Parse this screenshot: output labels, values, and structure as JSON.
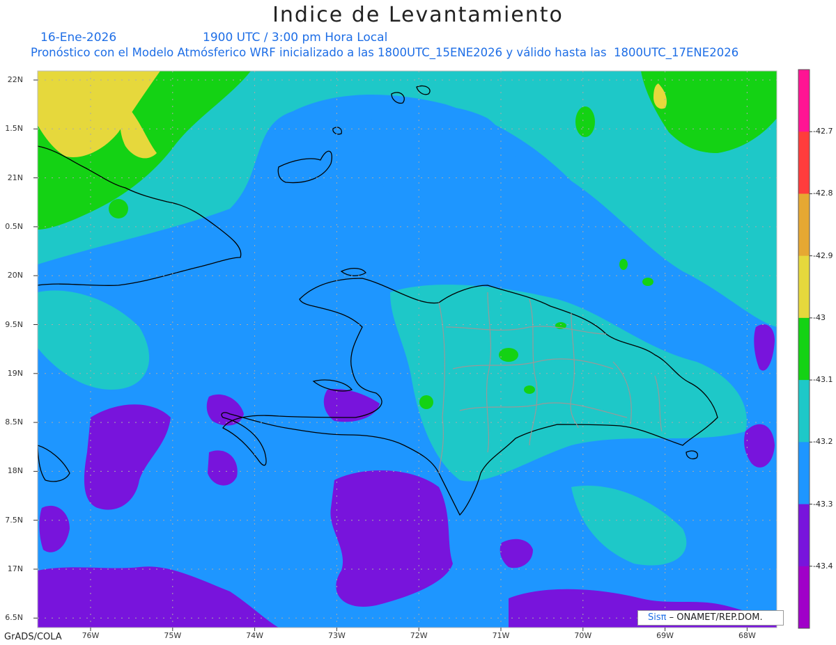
{
  "header": {
    "title": "Indice de Levantamiento",
    "date": "16-Ene-2026",
    "time": "1900 UTC / 3:00 pm Hora Local",
    "model_info": "Pronóstico con el Modelo Atmósferico WRF inicializado a las 1800UTC_15ENE2026 y válido hasta las  1800UTC_17ENE2026"
  },
  "axes": {
    "lat_labels": [
      "22N",
      "1.5N",
      "21N",
      "0.5N",
      "20N",
      "9.5N",
      "19N",
      "8.5N",
      "18N",
      "7.5N",
      "17N",
      "6.5N"
    ],
    "lon_labels": [
      "76W",
      "75W",
      "74W",
      "73W",
      "72W",
      "71W",
      "70W",
      "69W",
      "68W"
    ]
  },
  "colorbar": {
    "labels": [
      "-42.7",
      "-42.8",
      "-42.9",
      "-43",
      "-43.1",
      "-43.2",
      "-43.3",
      "-43.4"
    ],
    "colors": [
      "#ff1493",
      "#ff3c3c",
      "#e6a832",
      "#e6d83c",
      "#14d214",
      "#1ec8c8",
      "#1e96ff",
      "#7814dc",
      "#a000c8"
    ]
  },
  "palette": {
    "purple": "#7814dc",
    "blue": "#1e96ff",
    "cyan": "#1ec8c8",
    "green": "#14d214",
    "yellow": "#e6d83c",
    "orange": "#e6a832"
  },
  "credit": {
    "sis": "Sisπ",
    "text": " – ONAMET/REP.DOM."
  },
  "footer": "GrADS/COLA"
}
